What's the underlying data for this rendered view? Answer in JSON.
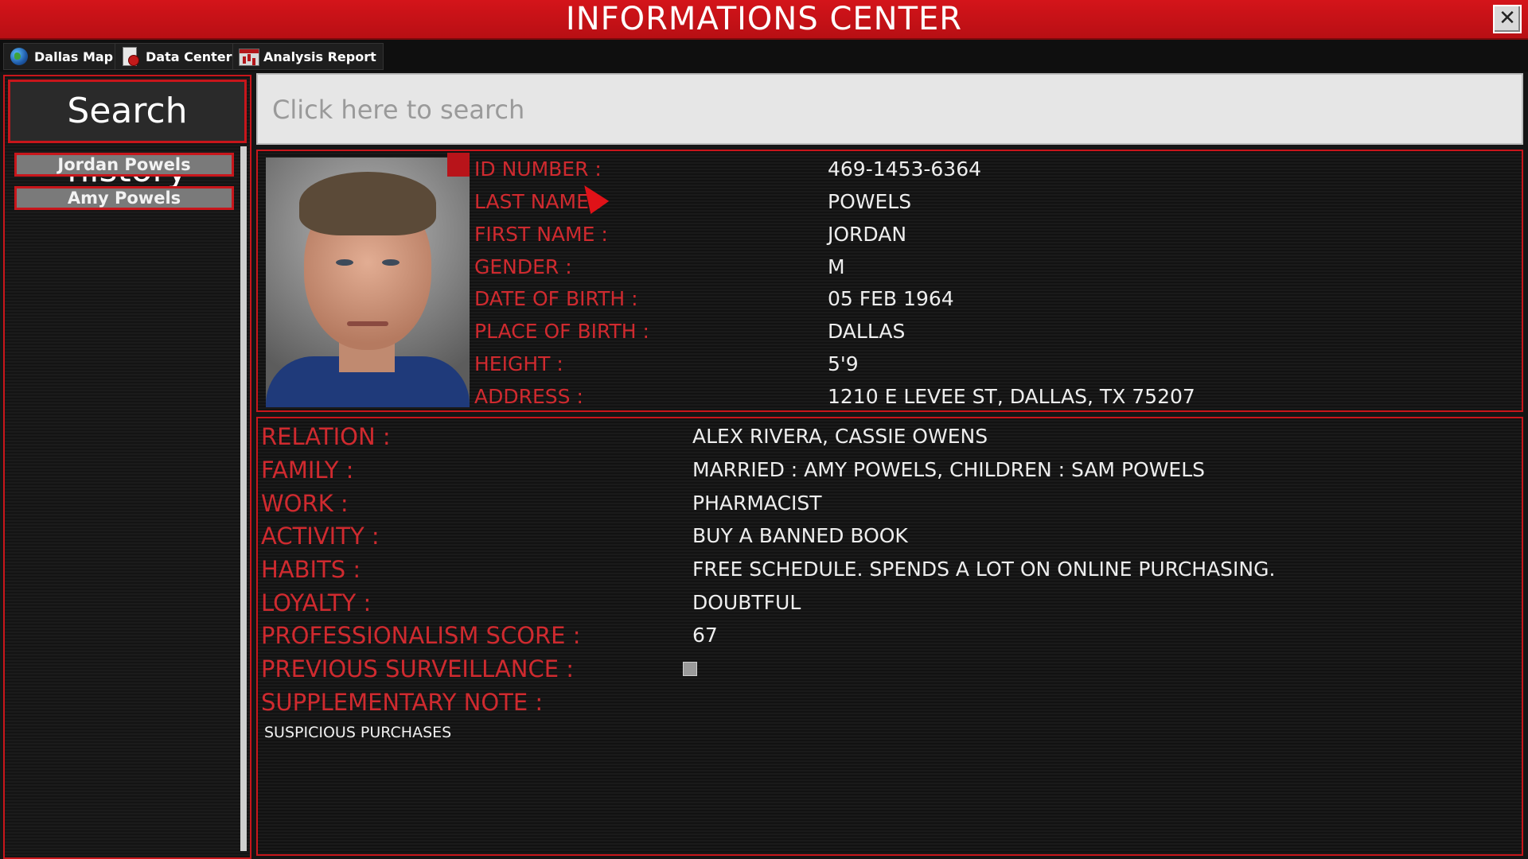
{
  "window": {
    "title": "INFORMATIONS CENTER",
    "close_glyph": "✕"
  },
  "toolbar": {
    "buttons": [
      {
        "label": "Dallas Map",
        "icon": "globe-icon"
      },
      {
        "label": "Data Center",
        "icon": "document-icon"
      },
      {
        "label": "Analysis Report",
        "icon": "report-chart-icon"
      }
    ]
  },
  "sidebar": {
    "title": "Search history",
    "items": [
      {
        "label": "Jordan Powels"
      },
      {
        "label": "Amy Powels"
      }
    ]
  },
  "search": {
    "placeholder": "Click here to search",
    "value": ""
  },
  "profile": {
    "fields": [
      {
        "label": "ID NUMBER :",
        "value": "469-1453-6364"
      },
      {
        "label": "LAST NAME :",
        "value": "POWELS"
      },
      {
        "label": "FIRST NAME :",
        "value": "JORDAN"
      },
      {
        "label": "GENDER :",
        "value": "M"
      },
      {
        "label": "DATE OF BIRTH :",
        "value": "05 FEB 1964"
      },
      {
        "label": "PLACE OF BIRTH :",
        "value": "DALLAS"
      },
      {
        "label": "HEIGHT :",
        "value": "5'9"
      },
      {
        "label": "ADDRESS :",
        "value": "1210 E LEVEE ST, DALLAS, TX 75207"
      }
    ]
  },
  "details": {
    "fields": [
      {
        "label": "RELATION :",
        "value": "ALEX RIVERA, CASSIE OWENS"
      },
      {
        "label": "FAMILY :",
        "value": "MARRIED : AMY POWELS, CHILDREN : SAM POWELS"
      },
      {
        "label": "WORK :",
        "value": "PHARMACIST"
      },
      {
        "label": "ACTIVITY :",
        "value": "BUY A BANNED BOOK"
      },
      {
        "label": "HABITS :",
        "value": "FREE SCHEDULE. SPENDS A LOT ON ONLINE PURCHASING."
      },
      {
        "label": "LOYALTY :",
        "value": "DOUBTFUL"
      },
      {
        "label": "PROFESSIONALISM SCORE :",
        "value": "67"
      },
      {
        "label": "PREVIOUS SURVEILLANCE :",
        "value": ""
      },
      {
        "label": "SUPPLEMENTARY NOTE :",
        "value": ""
      }
    ],
    "previous_surveillance_checked": false,
    "note": "SUSPICIOUS PURCHASES"
  },
  "colors": {
    "accent_red": "#c8161b",
    "label_red": "#cf2a2f",
    "title_bar": "#d4141a"
  }
}
